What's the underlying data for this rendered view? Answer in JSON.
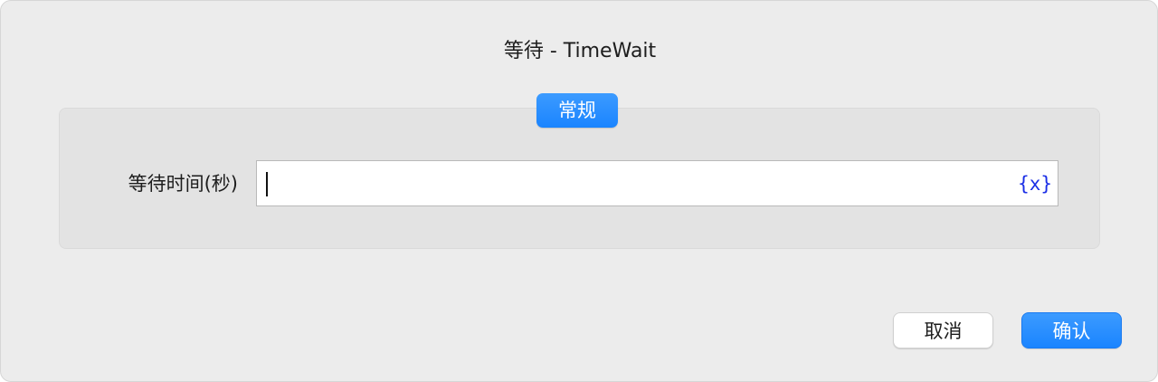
{
  "dialog": {
    "title": "等待 - TimeWait"
  },
  "group": {
    "tab_label": "常规"
  },
  "wait_time": {
    "label": "等待时间(秒)",
    "value": "",
    "variable_icon_text": "{x}",
    "variable_icon_name": "variable-icon"
  },
  "buttons": {
    "cancel_label": "取消",
    "ok_label": "确认"
  },
  "colors": {
    "accent": "#1a84ff",
    "variable_icon": "#1a2ee6",
    "dialog_background": "#ececec",
    "group_background": "#e3e3e3"
  }
}
